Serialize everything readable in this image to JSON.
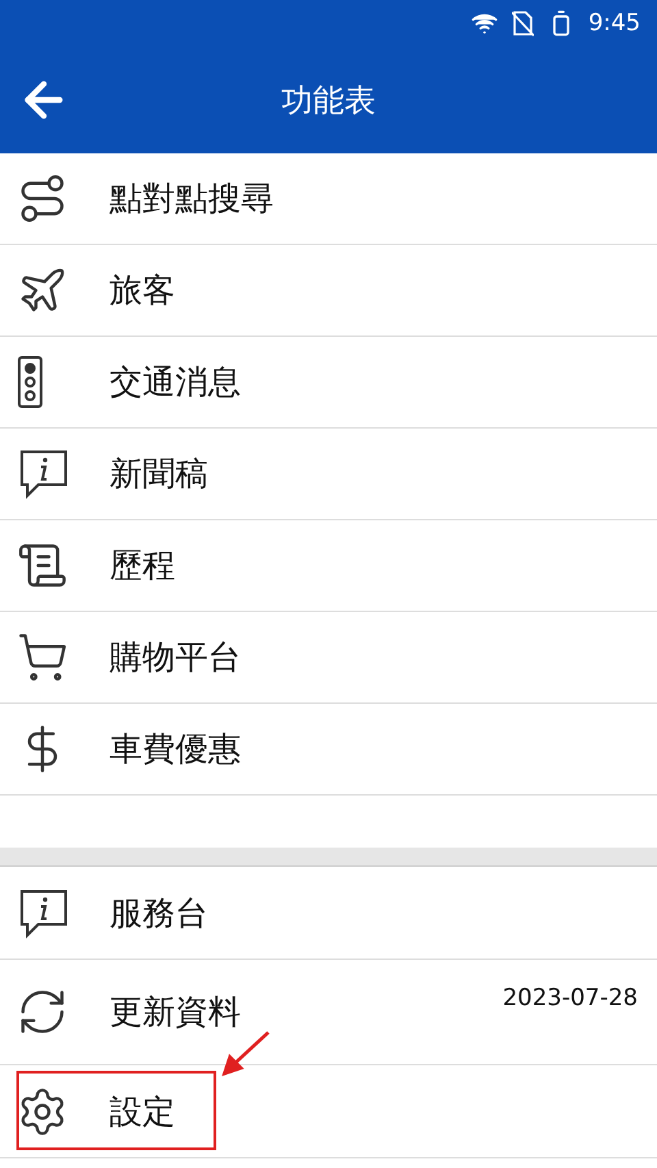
{
  "status_bar": {
    "time": "9:45"
  },
  "app_bar": {
    "title": "功能表"
  },
  "menu": [
    {
      "label": "點對點搜尋",
      "kind": "route"
    },
    {
      "label": "旅客",
      "kind": "traveler"
    },
    {
      "label": "交通消息",
      "kind": "traffic"
    },
    {
      "label": "新聞稿",
      "kind": "info"
    },
    {
      "label": "歷程",
      "kind": "history"
    },
    {
      "label": "購物平台",
      "kind": "cart"
    },
    {
      "label": "車費優惠",
      "kind": "dollar"
    }
  ],
  "secondary_menu": [
    {
      "label": "服務台",
      "kind": "info",
      "highlighted": false
    },
    {
      "label": "更新資料",
      "kind": "refresh",
      "date": "2023-07-28",
      "highlighted": false
    },
    {
      "label": "設定",
      "kind": "settings",
      "highlighted": true
    }
  ]
}
